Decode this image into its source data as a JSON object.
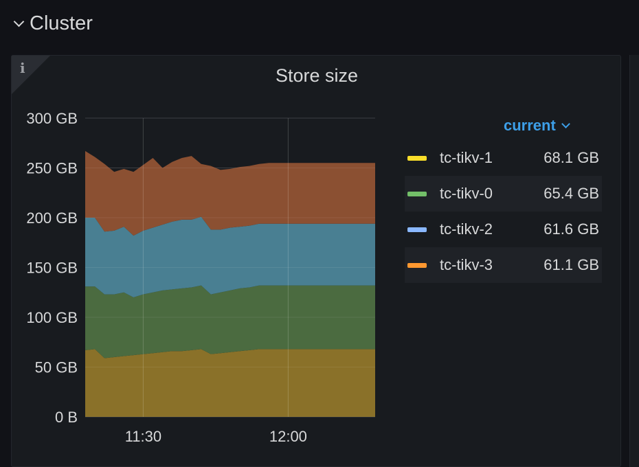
{
  "row": {
    "title": "Cluster"
  },
  "panel": {
    "title": "Store size",
    "info_icon": "i"
  },
  "legend": {
    "header": "current",
    "items": [
      {
        "name": "tc-tikv-1",
        "value": "68.1 GB",
        "color": "#fade2a"
      },
      {
        "name": "tc-tikv-0",
        "value": "65.4 GB",
        "color": "#73bf69"
      },
      {
        "name": "tc-tikv-2",
        "value": "61.6 GB",
        "color": "#8ab8ff"
      },
      {
        "name": "tc-tikv-3",
        "value": "61.1 GB",
        "color": "#ff9830"
      }
    ]
  },
  "chart_data": {
    "type": "area",
    "stacked": true,
    "title": "Store size",
    "xlabel": "",
    "ylabel": "",
    "ylim": [
      0,
      300
    ],
    "y_unit": "GB",
    "y_ticks": [
      "0 B",
      "50 GB",
      "100 GB",
      "150 GB",
      "200 GB",
      "250 GB",
      "300 GB"
    ],
    "x_ticks": [
      "11:30",
      "12:00"
    ],
    "x": [
      "11:18",
      "11:20",
      "11:22",
      "11:24",
      "11:26",
      "11:28",
      "11:30",
      "11:32",
      "11:34",
      "11:36",
      "11:38",
      "11:40",
      "11:42",
      "11:44",
      "11:46",
      "11:48",
      "11:50",
      "11:52",
      "11:54",
      "11:56",
      "11:58",
      "12:00",
      "12:02",
      "12:04",
      "12:06",
      "12:08",
      "12:10",
      "12:12",
      "12:14",
      "12:16",
      "12:18"
    ],
    "series": [
      {
        "name": "tc-tikv-1",
        "color": "#8a7129",
        "values": [
          67,
          68,
          59,
          60,
          61,
          62,
          63,
          64,
          65,
          66,
          66,
          67,
          68,
          63,
          64,
          65,
          66,
          67,
          68,
          68,
          68,
          68,
          68,
          68,
          68,
          68,
          68,
          68,
          68,
          68,
          68
        ]
      },
      {
        "name": "tc-tikv-0",
        "color": "#4b6b40",
        "values": [
          64,
          63,
          64,
          63,
          64,
          58,
          60,
          61,
          62,
          62,
          63,
          63,
          64,
          60,
          61,
          62,
          63,
          63,
          64,
          64,
          64,
          64,
          64,
          64,
          64,
          64,
          64,
          64,
          64,
          64,
          64
        ]
      },
      {
        "name": "tc-tikv-2",
        "color": "#497f92",
        "values": [
          69,
          69,
          63,
          64,
          66,
          62,
          64,
          65,
          66,
          68,
          69,
          68,
          69,
          65,
          63,
          63,
          62,
          62,
          62,
          62,
          62,
          62,
          62,
          62,
          62,
          62,
          62,
          62,
          62,
          62,
          62
        ]
      },
      {
        "name": "tc-tikv-3",
        "color": "#8b5032",
        "values": [
          67,
          61,
          68,
          59,
          58,
          64,
          66,
          70,
          57,
          60,
          62,
          64,
          53,
          64,
          60,
          59,
          60,
          60,
          60,
          61,
          61,
          61,
          61,
          61,
          61,
          61,
          61,
          61,
          61,
          61,
          61
        ]
      }
    ],
    "grid": true,
    "legend_position": "right"
  }
}
